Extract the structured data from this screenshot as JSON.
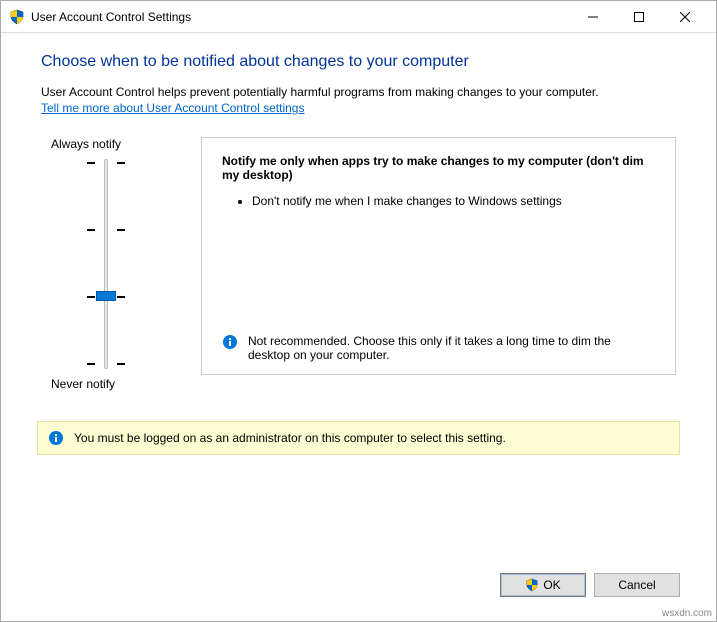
{
  "window": {
    "title": "User Account Control Settings"
  },
  "heading": "Choose when to be notified about changes to your computer",
  "description": "User Account Control helps prevent potentially harmful programs from making changes to your computer.",
  "help_link": "Tell me more about User Account Control settings",
  "slider": {
    "top_label": "Always notify",
    "bottom_label": "Never notify",
    "levels": 4,
    "current_level": 1
  },
  "detail": {
    "title": "Notify me only when apps try to make changes to my computer (don't dim my desktop)",
    "bullet": "Don't notify me when I make changes to Windows settings",
    "footer": "Not recommended. Choose this only if it takes a long time to dim the desktop on your computer."
  },
  "admin_notice": "You must be logged on as an administrator on this computer to select this setting.",
  "buttons": {
    "ok": "OK",
    "cancel": "Cancel"
  },
  "watermark": "wsxdn.com"
}
